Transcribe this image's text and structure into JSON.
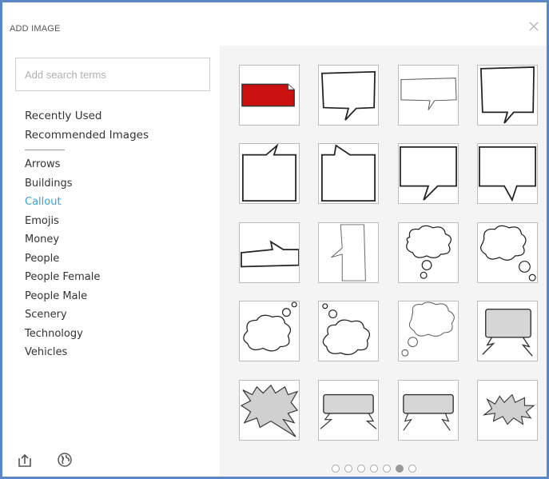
{
  "dialog": {
    "title": "ADD IMAGE",
    "close_icon": "close-icon"
  },
  "search": {
    "placeholder": "Add search terms",
    "value": ""
  },
  "categories": {
    "top": [
      {
        "label": "Recently Used"
      },
      {
        "label": "Recommended Images"
      }
    ],
    "list": [
      {
        "label": "Arrows"
      },
      {
        "label": "Buildings"
      },
      {
        "label": "Callout",
        "active": true
      },
      {
        "label": "Emojis"
      },
      {
        "label": "Money"
      },
      {
        "label": "People"
      },
      {
        "label": "People Female"
      },
      {
        "label": "People Male"
      },
      {
        "label": "Scenery"
      },
      {
        "label": "Technology"
      },
      {
        "label": "Vehicles"
      }
    ]
  },
  "bottom_icons": [
    "upload-icon",
    "globe-icon"
  ],
  "images": [
    "red-banner-callout",
    "speech-bubble-tail-bottom",
    "thin-bubble-tail",
    "square-bubble-tail",
    "bubble-tail-top-left",
    "bubble-tail-top-middle",
    "wide-bubble-tail-bottom-left",
    "wide-bubble-tail-bottom-right",
    "arrow-banner-callout",
    "tall-narrow-bubble",
    "thought-cloud-bottom",
    "thought-cloud-bottom-right",
    "thought-cloud-top-right",
    "thought-cloud-top-left",
    "thought-cloud-bottom-left",
    "gray-shout-bubble",
    "spiky-burst-callout",
    "gray-shout-wide-left",
    "gray-shout-wide",
    "spiky-burst-small"
  ],
  "pagination": {
    "total": 7,
    "current": 6
  },
  "colors": {
    "accent": "#3aa0d8",
    "frame": "#5b87c5",
    "panel": "#f4f4f5",
    "banner_red": "#cc1111"
  }
}
